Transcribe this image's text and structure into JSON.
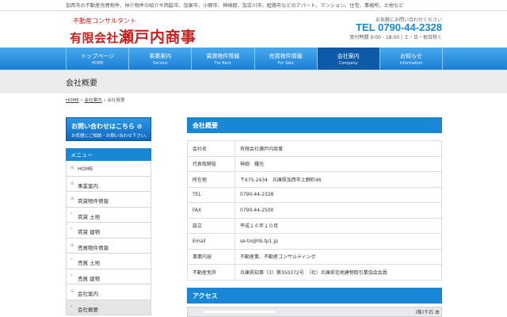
{
  "topline": "加西市の不動産売買物件、仲介物件の紹介や西脇市、加東市、小野市、神崎郡、加古川市、姫路市などのアパート、マンション、住宅、事務所、土地など",
  "logo": {
    "sub": "不動産コンサルタント",
    "prefix": "有限会社",
    "name": "瀬戸内商事"
  },
  "contact": {
    "note": "お気軽にお問い合わせください",
    "tel": "TEL 0790-44-2328",
    "hours": "受付時間 9:00 - 18:00 | 土・日・祝日除く"
  },
  "nav": [
    {
      "jp": "トップページ",
      "en": "HOME"
    },
    {
      "jp": "事業案内",
      "en": "Service"
    },
    {
      "jp": "賃貸物件情報",
      "en": "For Rent"
    },
    {
      "jp": "売買物件情報",
      "en": "For Sale"
    },
    {
      "jp": "会社案内",
      "en": "Company"
    },
    {
      "jp": "お知らせ",
      "en": "Information"
    }
  ],
  "page_title": "会社概要",
  "breadcrumb": {
    "home": "HOME",
    "sep": "»",
    "parent": "会社案内",
    "current": "会社概要"
  },
  "inquiry": {
    "line1": "お問い合わせはこちら ⊙",
    "line2": "お気軽にご相談・お問い合わせ下さい。"
  },
  "sidebar": {
    "heading": "メニュー",
    "items": [
      {
        "mark": "⊞",
        "label": "HOME"
      },
      {
        "mark": "⊞",
        "label": "事業案内"
      },
      {
        "mark": "⊞",
        "label": "賃貸物件情報"
      },
      {
        "mark": "*",
        "label": "賃貸 土地"
      },
      {
        "mark": "*",
        "label": "賃貸 建物"
      },
      {
        "mark": "⊞",
        "label": "売買物件情報"
      },
      {
        "mark": "*",
        "label": "売買 土地"
      },
      {
        "mark": "*",
        "label": "売買 建物"
      },
      {
        "mark": "⊞",
        "label": "会社案内"
      },
      {
        "mark": "*",
        "label": "会社概要"
      }
    ]
  },
  "company_section": {
    "heading": "会社概要",
    "rows": [
      {
        "key": "会社名",
        "value": "有限会社瀬戸内商事"
      },
      {
        "key": "代表取締役",
        "value": "神田　耀也"
      },
      {
        "key": "所在地",
        "value": "〒675-2434　兵庫県加西市上野町46"
      },
      {
        "key": "TEL",
        "value": "0790-44-2328"
      },
      {
        "key": "FAX",
        "value": "0790-44-2500"
      },
      {
        "key": "設立",
        "value": "平成１６年１０月"
      },
      {
        "key": "Email",
        "value": "se-to@hb.tp1.jp"
      },
      {
        "key": "事業内容",
        "value": "不動産業、不動産コンサルティング"
      },
      {
        "key": "不動産免許",
        "value": "兵庫県知事（3）第350372号　（社）兵庫県宅地建物取引業協会会員"
      }
    ]
  },
  "access_section": {
    "heading": "アクセス",
    "map_label": "(株)千石 本"
  }
}
